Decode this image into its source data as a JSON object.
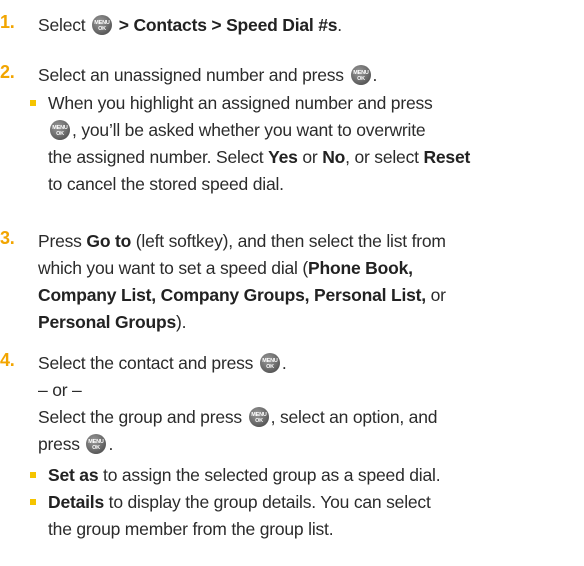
{
  "brand": {
    "accent": "#f2a500",
    "bullet": "#f5c400",
    "text": "#2b2b2b"
  },
  "key_icon": {
    "name": "menu-ok-key-icon",
    "top": "MENU",
    "bottom": "OK"
  },
  "step1": {
    "num": "1.",
    "pre": "Select ",
    "path": "> Contacts > Speed Dial #s",
    "post": "."
  },
  "step2": {
    "num": "2.",
    "text": "Select an unassigned number and press",
    "end": ".",
    "bullet": {
      "l1": "When you highlight an assigned number and press",
      "l2": ", you’ll be asked whether you want to overwrite",
      "l3a": "the assigned number. Select ",
      "yes": "Yes",
      "l3b": " or ",
      "no": "No",
      "l3c": ", or select ",
      "reset": "Reset",
      "l4": "to cancel the stored speed dial."
    }
  },
  "step3": {
    "num": "3.",
    "pre": "Press ",
    "goto": "Go to",
    "l1b": " (left softkey), and then select the list from",
    "l2": "which you want to set a speed dial (",
    "phonebook": "Phone Book,",
    "company_list": "Company List, Company Groups, Personal List,",
    "or": " or",
    "personal_groups": "Personal Groups",
    "end": ")."
  },
  "step4": {
    "num": "4.",
    "text": "Select the contact and press",
    "end": ".",
    "or_line": "– or –",
    "alt_l1a": "Select the group and press",
    "alt_l1b": ", select an option, and",
    "alt_l2": "press",
    "alt_end": ".",
    "bullets": {
      "set_as": "Set as",
      "set_as_rest": " to assign the selected group as a speed dial.",
      "details": "Details",
      "details_rest": " to display the group details. You can select",
      "details_l2": "the group member from the group list."
    }
  }
}
